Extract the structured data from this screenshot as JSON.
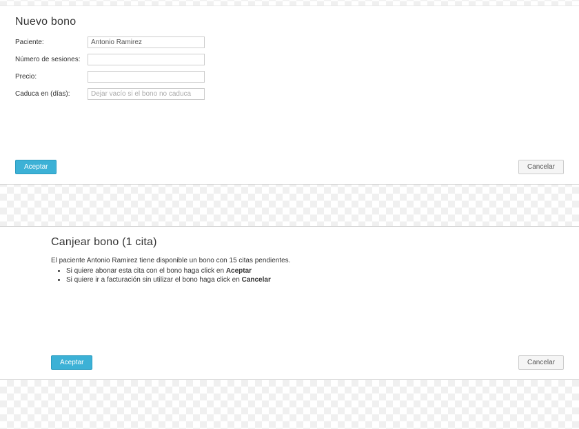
{
  "new_voucher": {
    "title": "Nuevo bono",
    "fields": {
      "patient_label": "Paciente:",
      "patient_value": "Antonio Ramirez",
      "sessions_label": "Número de sesiones:",
      "sessions_value": "",
      "price_label": "Precio:",
      "price_value": "",
      "expiry_label": "Caduca en (días):",
      "expiry_value": "",
      "expiry_placeholder": "Dejar vacío si el bono no caduca"
    },
    "buttons": {
      "accept": "Aceptar",
      "cancel": "Cancelar"
    }
  },
  "redeem_voucher": {
    "title": "Canjear bono (1 cita)",
    "intro": "El paciente Antonio Ramirez tiene disponible un bono con 15 citas pendientes.",
    "option1_prefix": "Si quiere abonar esta cita con el bono haga click en ",
    "option1_bold": "Aceptar",
    "option2_prefix": "Si quiere ir a facturación sin utilizar el bono haga click en ",
    "option2_bold": "Cancelar",
    "buttons": {
      "accept": "Aceptar",
      "cancel": "Cancelar"
    }
  }
}
